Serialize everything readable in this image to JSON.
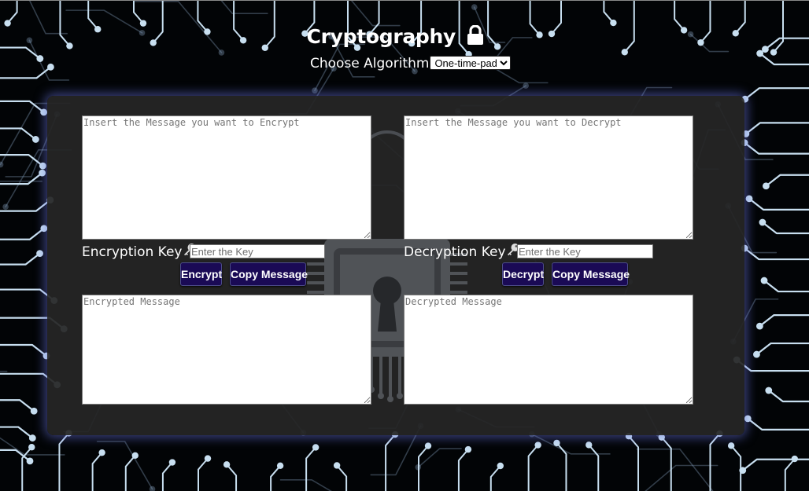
{
  "header": {
    "title": "Cryptography",
    "algorithm_label": "Choose Algorithm",
    "algorithm_selected": "One-time-pad"
  },
  "encrypt": {
    "message_placeholder": "Insert the Message you want to Encrypt",
    "key_label": "Encryption Key",
    "key_placeholder": "Enter the Key",
    "action_button": "Encrypt",
    "copy_button": "Copy Message",
    "output_placeholder": "Encrypted Message"
  },
  "decrypt": {
    "message_placeholder": "Insert the Message you want to Decrypt",
    "key_label": "Decryption Key",
    "key_placeholder": "Enter the Key",
    "action_button": "Decrypt",
    "copy_button": "Copy Message",
    "output_placeholder": "Decrypted Message"
  },
  "icons": {
    "title_icon": "lock-icon",
    "key_icon": "key-icon",
    "background": "circuit-board-background",
    "panel_watermark": "padlock-watermark"
  },
  "colors": {
    "button_bg": "#1a0a55",
    "panel_bg": "#262626",
    "panel_glow": "#6e78e6",
    "circuit": "#c8dff0"
  }
}
